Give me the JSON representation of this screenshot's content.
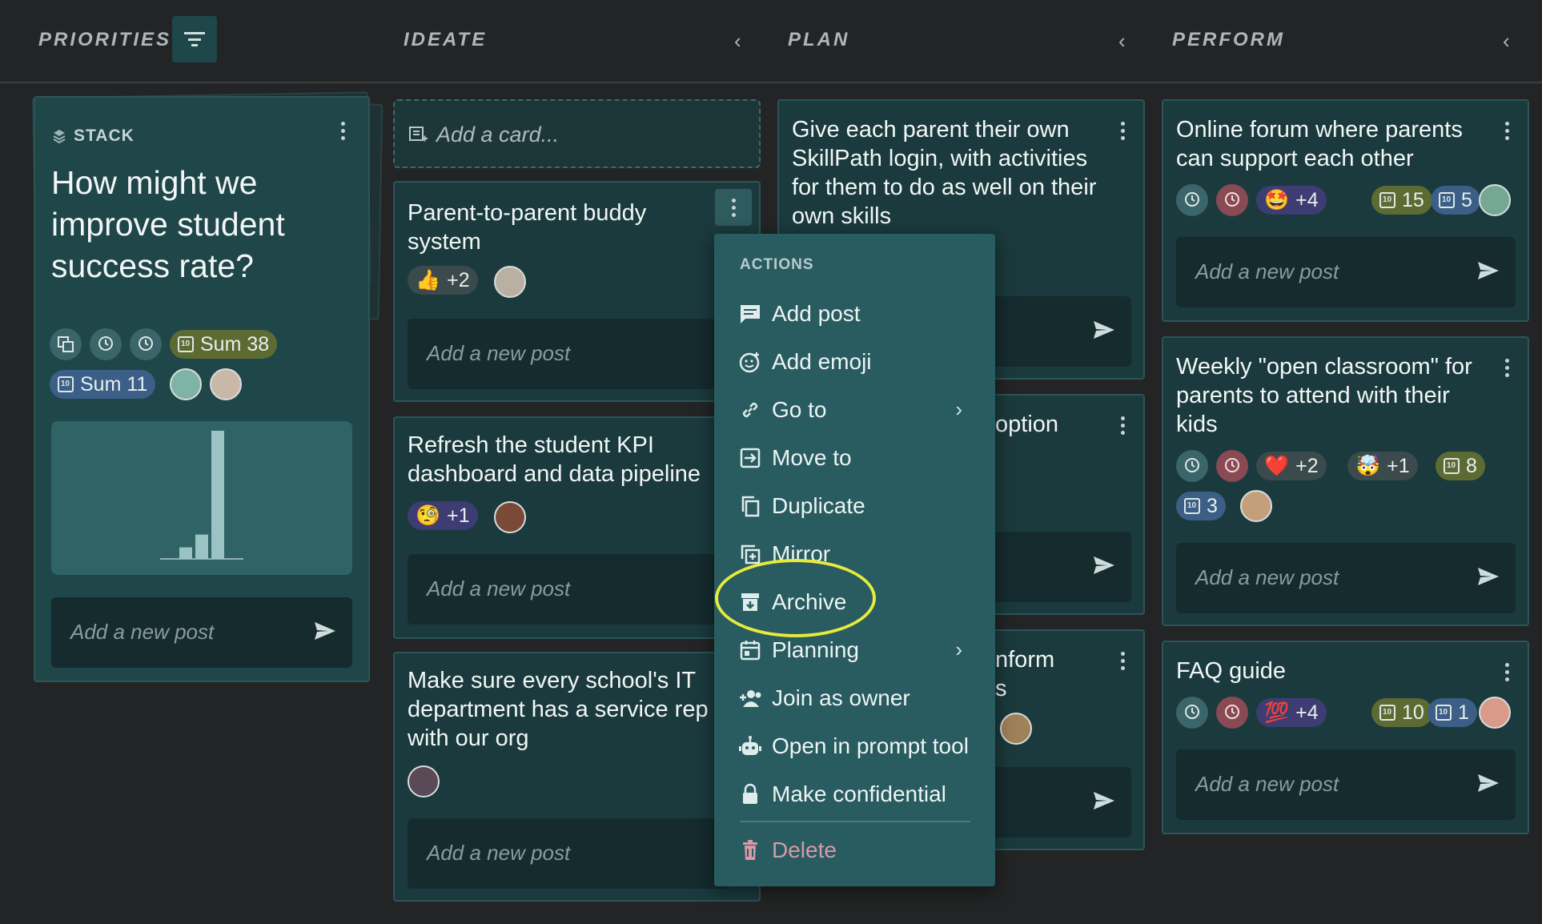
{
  "columns": {
    "priorities": "PRIORITIES",
    "ideate": "IDEATE",
    "plan": "PLAN",
    "perform": "PERFORM"
  },
  "stack": {
    "label": "STACK",
    "title": "How might we improve student success rate?",
    "sum1": "Sum 38",
    "sum2": "Sum 11",
    "chart_bars": [
      0.09,
      0.19,
      1.0
    ],
    "post_placeholder": "Add a new post"
  },
  "ideate": {
    "add_card": "Add a card...",
    "cards": [
      {
        "title": "Parent-to-parent buddy system",
        "reaction_count": "+2",
        "post_placeholder": "Add a new post"
      },
      {
        "title": "Refresh the student KPI dashboard and data pipeline",
        "reaction_count": "+1",
        "post_placeholder": "Add a new post"
      },
      {
        "title": "Make sure every school's IT department has a service rep with our org",
        "post_placeholder": "Add a new post"
      }
    ]
  },
  "plan": {
    "cards": [
      {
        "title": "Give each parent their own SkillPath login, with activities for them to do as well on their own skills"
      },
      {
        "title_fragment": "option"
      },
      {
        "title_fragment_1": "nform",
        "title_fragment_2": "s"
      }
    ]
  },
  "perform": {
    "cards": [
      {
        "title": "Online forum where parents can support each other",
        "emoji_count": "+4",
        "olive": "15",
        "blue": "5",
        "post_placeholder": "Add a new post"
      },
      {
        "title": "Weekly \"open classroom\" for parents to attend with their kids",
        "emoji1_count": "+2",
        "emoji2_count": "+1",
        "olive": "8",
        "blue": "3",
        "post_placeholder": "Add a new post"
      },
      {
        "title": "FAQ guide",
        "emoji_count": "+4",
        "olive": "10",
        "blue": "1",
        "post_placeholder": "Add a new post"
      }
    ]
  },
  "menu": {
    "header": "ACTIONS",
    "items": [
      "Add post",
      "Add emoji",
      "Go to",
      "Move to",
      "Duplicate",
      "Mirror",
      "Archive",
      "Planning",
      "Join as owner",
      "Open in prompt tool",
      "Make confidential",
      "Delete"
    ]
  },
  "emojis": {
    "thumbs": "👍",
    "pleading": "🥺",
    "monocle": "🧐",
    "starstruck": "🤩",
    "heart": "❤️",
    "mindblown": "🤯",
    "hundred": "💯"
  },
  "colors": {
    "accent_highlight": "#e6ea3c",
    "delete": "#d59aa6"
  }
}
